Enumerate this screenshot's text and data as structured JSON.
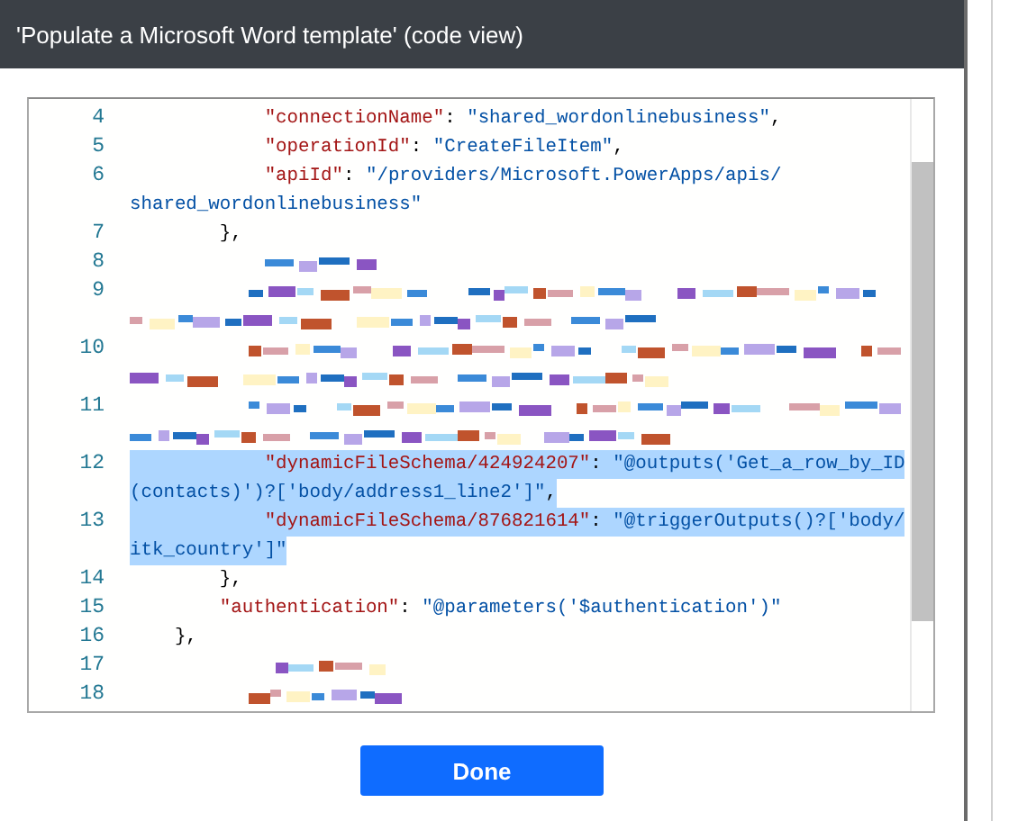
{
  "dialog": {
    "title": "'Populate a Microsoft Word template' (code view)"
  },
  "code_lines": [
    {
      "number": "4",
      "kind": "code",
      "selected": false,
      "rows": [
        {
          "key": "            \"connectionName\"",
          "colon": ": ",
          "string": "\"shared_wordonlinebusiness\"",
          "punct": ","
        }
      ]
    },
    {
      "number": "5",
      "kind": "code",
      "selected": false,
      "rows": [
        {
          "key": "            \"operationId\"",
          "colon": ": ",
          "string": "\"CreateFileItem\"",
          "punct": ","
        }
      ]
    },
    {
      "number": "6",
      "kind": "code",
      "selected": false,
      "rows": [
        {
          "key": "            \"apiId\"",
          "colon": ": ",
          "string": "\"/providers/Microsoft.PowerApps/apis/"
        },
        {
          "string": "shared_wordonlinebusiness\""
        }
      ]
    },
    {
      "number": "7",
      "kind": "code",
      "selected": false,
      "rows": [
        {
          "punct": "        },"
        }
      ]
    },
    {
      "number": "8",
      "kind": "garbled",
      "selected": false,
      "wrapped": false
    },
    {
      "number": "9",
      "kind": "garbled",
      "selected": false,
      "wrapped": true
    },
    {
      "number": "10",
      "kind": "garbled",
      "selected": false,
      "wrapped": true
    },
    {
      "number": "11",
      "kind": "garbled",
      "selected": false,
      "wrapped": true
    },
    {
      "number": "12",
      "kind": "code",
      "selected": true,
      "rows": [
        {
          "key": "            \"dynamicFileSchema/424924207\"",
          "colon": ": ",
          "string": "\"@outputs('Get_a_row_by_ID"
        },
        {
          "string": "(contacts)')?['body/address1_line2']\"",
          "punct": ","
        }
      ]
    },
    {
      "number": "13",
      "kind": "code",
      "selected": true,
      "rows": [
        {
          "key": "            \"dynamicFileSchema/876821614\"",
          "colon": ": ",
          "string": "\"@triggerOutputs()?['body/"
        },
        {
          "string": "itk_country']\""
        }
      ]
    },
    {
      "number": "14",
      "kind": "code",
      "selected": false,
      "rows": [
        {
          "punct": "        },"
        }
      ]
    },
    {
      "number": "15",
      "kind": "code",
      "selected": false,
      "rows": [
        {
          "key": "        \"authentication\"",
          "colon": ": ",
          "string": "\"@parameters('$authentication')\""
        }
      ]
    },
    {
      "number": "16",
      "kind": "code",
      "selected": false,
      "rows": [
        {
          "punct": "    },"
        }
      ]
    },
    {
      "number": "17",
      "kind": "garbled",
      "selected": false,
      "wrapped": false
    },
    {
      "number": "18",
      "kind": "garbled",
      "selected": false,
      "wrapped": false
    }
  ],
  "buttons": [
    {
      "label": "Done",
      "kind": "primary"
    }
  ]
}
